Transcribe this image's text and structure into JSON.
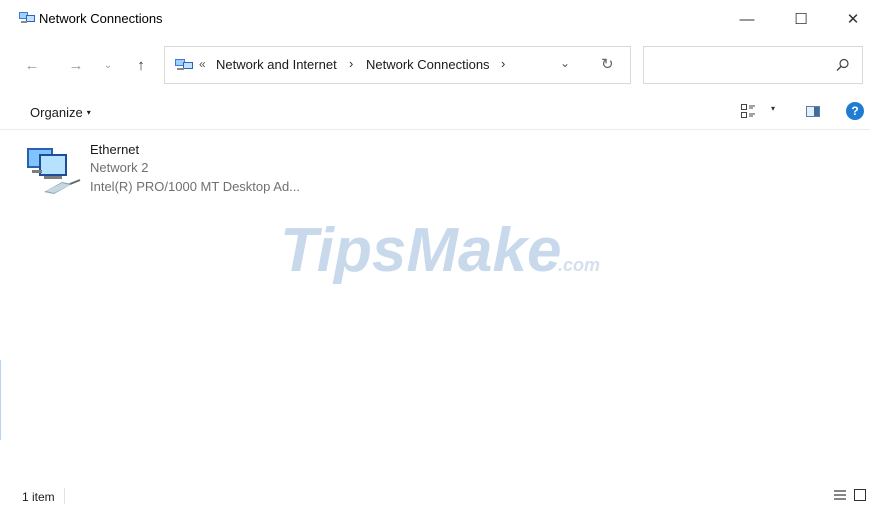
{
  "window": {
    "title": "Network Connections",
    "minimize_glyph": "—",
    "maximize_glyph": "☐",
    "close_glyph": "✕"
  },
  "nav": {
    "back_glyph": "←",
    "forward_glyph": "→",
    "recent_glyph": "⌄",
    "up_glyph": "↑"
  },
  "address": {
    "overflow_glyph": "«",
    "breadcrumbs": [
      "Network and Internet",
      "Network Connections"
    ],
    "separator": "›",
    "dropdown_glyph": "⌄",
    "refresh_glyph": "↻"
  },
  "search": {
    "placeholder": ""
  },
  "command_bar": {
    "organize_label": "Organize",
    "caret": "▾",
    "help_label": "?"
  },
  "items": [
    {
      "name": "Ethernet",
      "network": "Network 2",
      "adapter": "Intel(R) PRO/1000 MT Desktop Ad...",
      "icon": "network-adapter-icon"
    }
  ],
  "watermark": {
    "main": "TipsMake",
    "suffix": ".com"
  },
  "status": {
    "item_count": "1 item"
  },
  "colors": {
    "accent": "#1f7cd1",
    "watermark": "#c9d9ec",
    "secondary_text": "#707070"
  }
}
